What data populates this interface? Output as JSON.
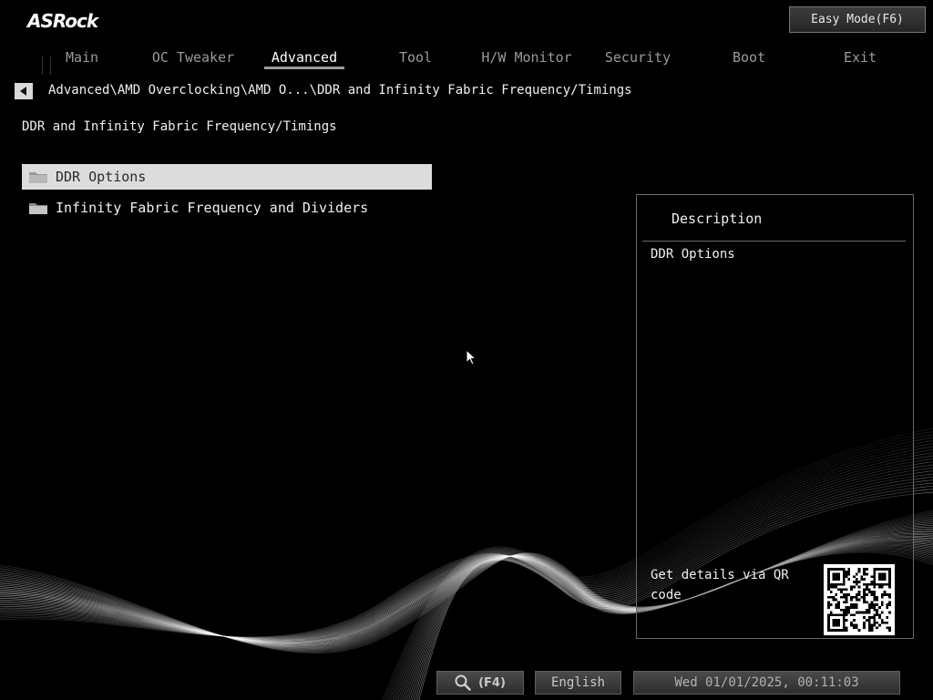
{
  "brand": {
    "logo": "ASRock"
  },
  "header": {
    "easy_mode_label": "Easy Mode(F6)"
  },
  "tabs": [
    {
      "label": "Main"
    },
    {
      "label": "OC Tweaker"
    },
    {
      "label": "Advanced"
    },
    {
      "label": "Tool"
    },
    {
      "label": "H/W Monitor"
    },
    {
      "label": "Security"
    },
    {
      "label": "Boot"
    },
    {
      "label": "Exit"
    }
  ],
  "active_tab": "Advanced",
  "breadcrumb": "Advanced\\AMD Overclocking\\AMD O...\\DDR and Infinity Fabric Frequency/Timings",
  "page_title": "DDR and Infinity Fabric Frequency/Timings",
  "menu": [
    {
      "label": "DDR Options",
      "icon": "folder-icon"
    },
    {
      "label": "Infinity Fabric Frequency and Dividers",
      "icon": "folder-icon"
    }
  ],
  "description": {
    "title": "Description",
    "text": "DDR Options",
    "qr_label": "Get details via QR code"
  },
  "footer": {
    "search_label": "(F4)",
    "language": "English",
    "datetime": "Wed 01/01/2025, 00:11:03"
  },
  "colors": {
    "background": "#000000",
    "selected_item": "#dcdcdc",
    "panel_border": "#6a6a6a"
  }
}
